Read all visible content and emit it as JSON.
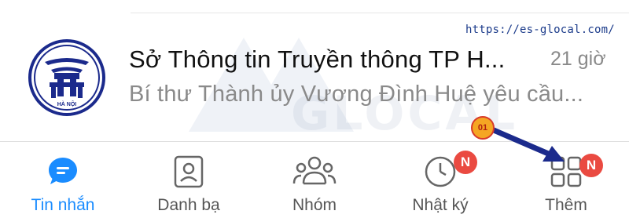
{
  "watermark": {
    "url": "https://es-glocal.com/",
    "background_text": "GLOCAL"
  },
  "chat": {
    "name": "Sở Thông tin Truyền thông TP H...",
    "time": "21 giờ",
    "preview": "Bí thư Thành ủy Vương Đình Huệ yêu cầu...",
    "avatar_icon": "ha-noi-emblem-icon",
    "avatar_text": "HÀ NỘI"
  },
  "nav": {
    "items": [
      {
        "label": "Tin nhắn",
        "icon": "chat-bubble-icon",
        "active": true
      },
      {
        "label": "Danh bạ",
        "icon": "contact-card-icon",
        "active": false
      },
      {
        "label": "Nhóm",
        "icon": "group-icon",
        "active": false
      },
      {
        "label": "Nhật ký",
        "icon": "clock-icon",
        "active": false,
        "badge": "N"
      },
      {
        "label": "Thêm",
        "icon": "grid-icon",
        "active": false,
        "badge": "N"
      }
    ]
  },
  "annotation": {
    "step": "01"
  },
  "colors": {
    "accent": "#1a8cff",
    "badge": "#ea4a41",
    "emblem": "#1b2a8c",
    "arrow": "#1b2a8c",
    "marker": "#f5a623"
  }
}
